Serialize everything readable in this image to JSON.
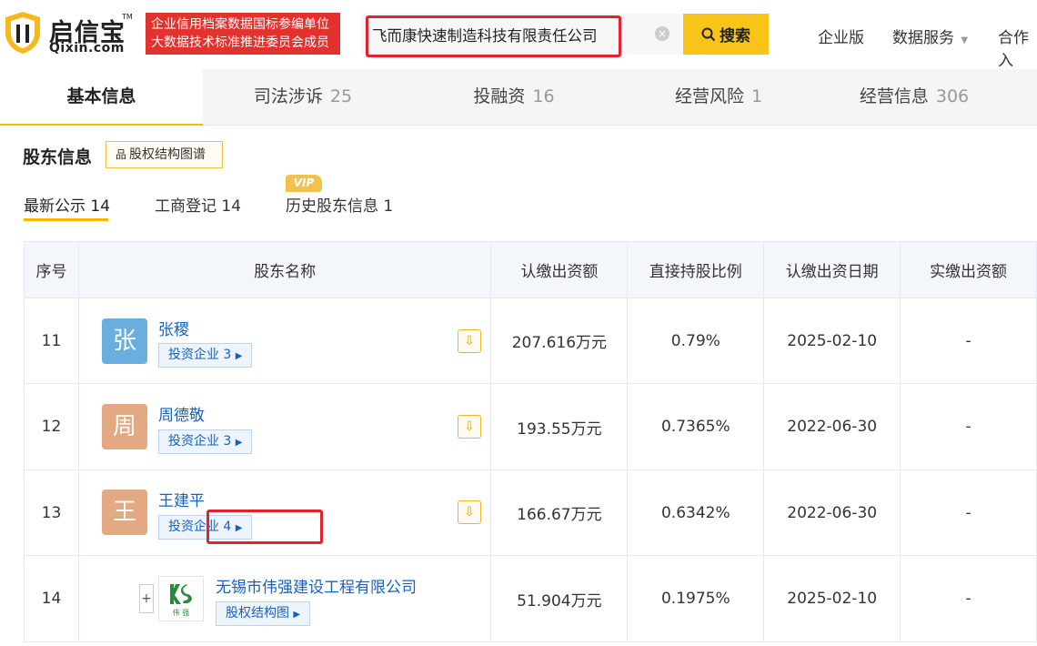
{
  "header": {
    "logo_cn": "启信宝",
    "logo_en": "Qixin.com",
    "logo_tm": "TM",
    "badge_line1": "企业信用档案数据国标参编单位",
    "badge_line2": "大数据技术标准推进委员会成员",
    "search_value": "飞而康快速制造科技有限责任公司",
    "search_button": "搜索",
    "nav": [
      "企业版",
      "数据服务",
      "合作入"
    ]
  },
  "tabs": [
    {
      "label": "基本信息",
      "count": ""
    },
    {
      "label": "司法涉诉",
      "count": "25"
    },
    {
      "label": "投融资",
      "count": "16"
    },
    {
      "label": "经营风险",
      "count": "1"
    },
    {
      "label": "经营信息",
      "count": "306"
    }
  ],
  "section": {
    "title": "股东信息",
    "equity_button": "股权结构图谱",
    "subtabs": [
      "最新公示 14",
      "工商登记 14",
      "历史股东信息 1"
    ],
    "vip": "VIP"
  },
  "table": {
    "headers": [
      "序号",
      "股东名称",
      "认缴出资额",
      "直接持股比例",
      "认缴出资日期",
      "实缴出资额"
    ],
    "rows": [
      {
        "idx": "11",
        "avatar": "张",
        "avatar_color": "#6aaede",
        "name": "张稷",
        "tag": "投资企业 3",
        "amount": "207.616万元",
        "pct": "0.79%",
        "date": "2025-02-10",
        "paid": "-"
      },
      {
        "idx": "12",
        "avatar": "周",
        "avatar_color": "#e2a982",
        "name": "周德敬",
        "tag": "投资企业 3",
        "amount": "193.55万元",
        "pct": "0.7365%",
        "date": "2022-06-30",
        "paid": "-"
      },
      {
        "idx": "13",
        "avatar": "王",
        "avatar_color": "#e2a982",
        "name": "王建平",
        "tag": "投资企业 4",
        "amount": "166.67万元",
        "pct": "0.6342%",
        "date": "2022-06-30",
        "paid": "-"
      },
      {
        "idx": "14",
        "avatar": "",
        "avatar_color": "",
        "name": "无锡市伟强建设工程有限公司",
        "tag": "股权结构图",
        "amount": "51.904万元",
        "pct": "0.1975%",
        "date": "2025-02-10",
        "paid": "-"
      }
    ],
    "company_logo_text": "伟 强",
    "expand_symbol": "+"
  }
}
